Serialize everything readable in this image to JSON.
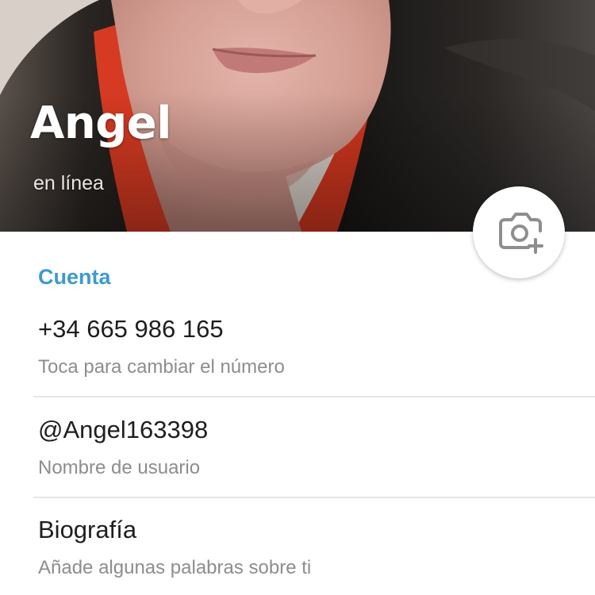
{
  "profile": {
    "name": "Angel",
    "status": "en línea",
    "photo": "profile-photo",
    "camera_icon": "camera-add-icon"
  },
  "account": {
    "section_title": "Cuenta",
    "phone": {
      "value": "+34 665 986 165",
      "hint": "Toca para cambiar el número"
    },
    "username": {
      "value": "@Angel163398",
      "hint": "Nombre de usuario"
    },
    "bio": {
      "value": "Biografía",
      "hint": "Añade algunas palabras sobre ti"
    }
  },
  "colors": {
    "accent": "#3e9ad0",
    "primary_text": "#1e1e1e",
    "secondary_text": "#8d8d8d",
    "divider": "#e6e6e6"
  }
}
